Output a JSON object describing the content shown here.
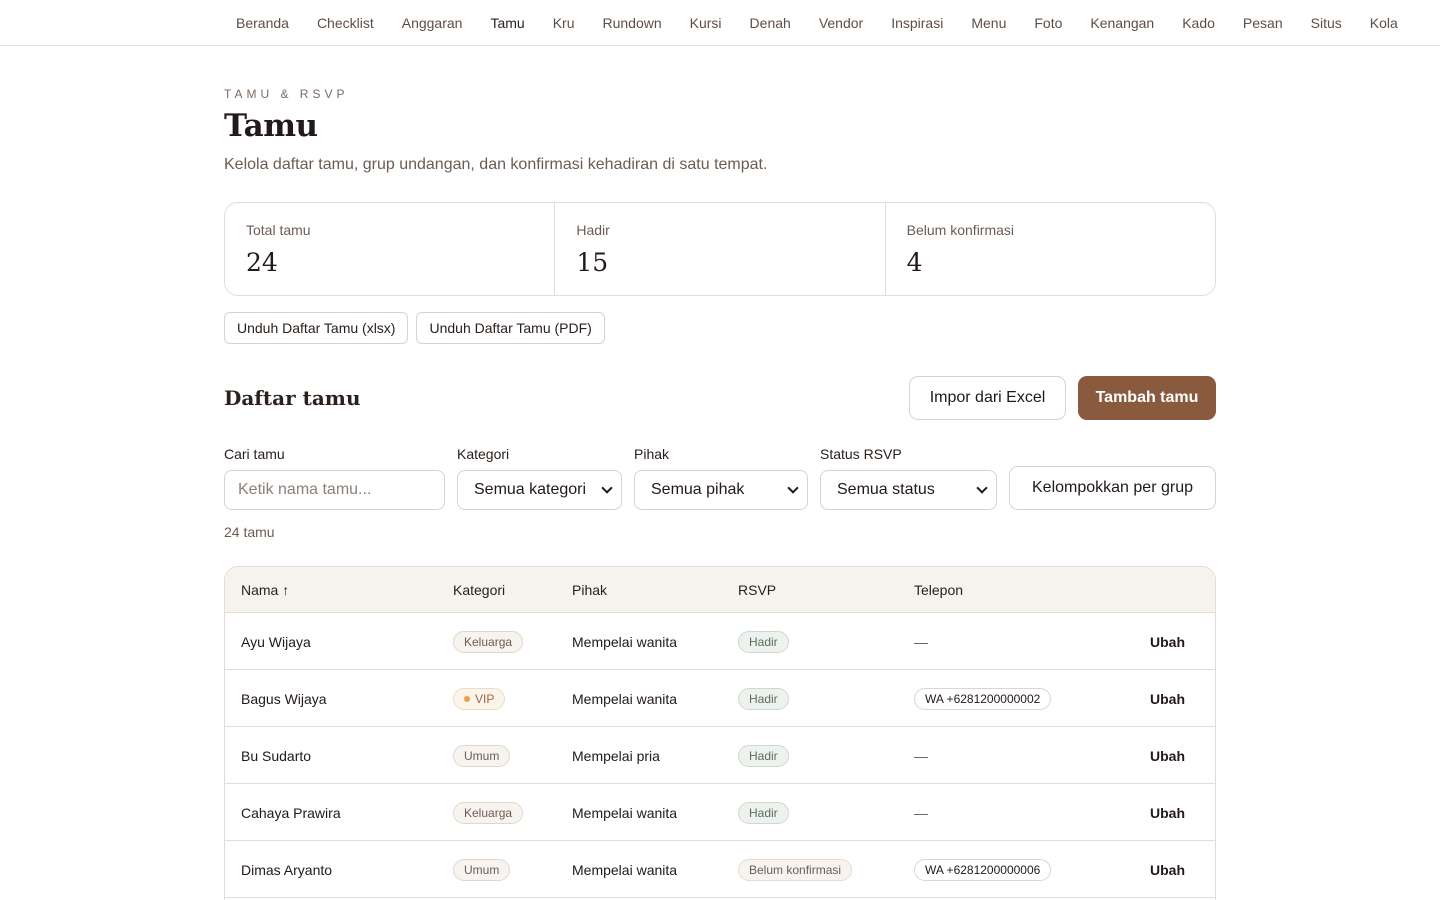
{
  "nav": {
    "items": [
      "Beranda",
      "Checklist",
      "Anggaran",
      "Tamu",
      "Kru",
      "Rundown",
      "Kursi",
      "Denah",
      "Vendor",
      "Inspirasi",
      "Menu",
      "Foto",
      "Kenangan",
      "Kado",
      "Pesan",
      "Situs",
      "Kola"
    ],
    "active": "Tamu"
  },
  "header": {
    "eyebrow": "TAMU & RSVP",
    "title": "Tamu",
    "subtitle": "Kelola daftar tamu, grup undangan, dan konfirmasi kehadiran di satu tempat."
  },
  "stats": [
    {
      "label": "Total tamu",
      "value": "24"
    },
    {
      "label": "Hadir",
      "value": "15"
    },
    {
      "label": "Belum konfirmasi",
      "value": "4"
    }
  ],
  "exports": {
    "xlsx": "Unduh Daftar Tamu (xlsx)",
    "pdf": "Unduh Daftar Tamu (PDF)"
  },
  "list": {
    "title": "Daftar tamu",
    "import_label": "Impor dari Excel",
    "add_label": "Tambah tamu",
    "count": "24 tamu"
  },
  "filters": {
    "search": {
      "label": "Cari tamu",
      "placeholder": "Ketik nama tamu..."
    },
    "category": {
      "label": "Kategori",
      "value": "Semua kategori"
    },
    "side": {
      "label": "Pihak",
      "value": "Semua pihak"
    },
    "status": {
      "label": "Status RSVP",
      "value": "Semua status"
    },
    "group_label": "Kelompokkan per grup"
  },
  "table": {
    "columns": {
      "name": "Nama ↑",
      "category": "Kategori",
      "side": "Pihak",
      "rsvp": "RSVP",
      "phone": "Telepon"
    },
    "rows": [
      {
        "name": "Ayu Wijaya",
        "category": "Keluarga",
        "side": "Mempelai wanita",
        "rsvp": "Hadir",
        "phone": "—",
        "action": "Ubah"
      },
      {
        "name": "Bagus Wijaya",
        "category": "VIP",
        "side": "Mempelai wanita",
        "rsvp": "Hadir",
        "phone": "WA +6281200000002",
        "action": "Ubah"
      },
      {
        "name": "Bu Sudarto",
        "category": "Umum",
        "side": "Mempelai pria",
        "rsvp": "Hadir",
        "phone": "—",
        "action": "Ubah"
      },
      {
        "name": "Cahaya Prawira",
        "category": "Keluarga",
        "side": "Mempelai wanita",
        "rsvp": "Hadir",
        "phone": "—",
        "action": "Ubah"
      },
      {
        "name": "Dimas Aryanto",
        "category": "Umum",
        "side": "Mempelai wanita",
        "rsvp": "Belum konfirmasi",
        "phone": "WA +6281200000006",
        "action": "Ubah"
      }
    ]
  }
}
